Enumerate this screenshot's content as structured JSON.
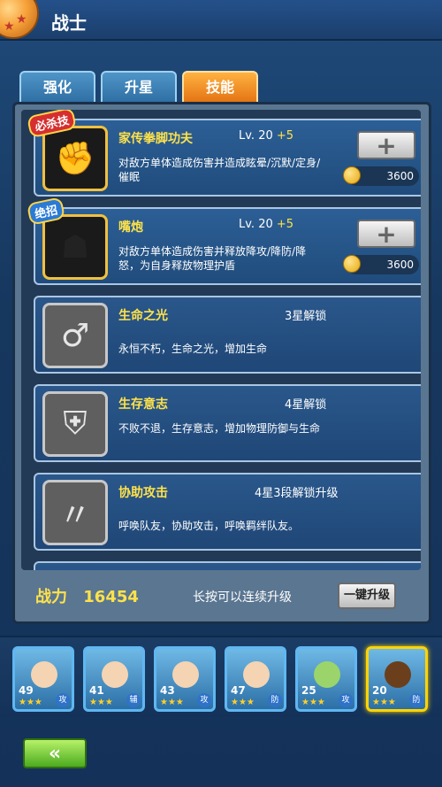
{
  "header": {
    "title": "战士"
  },
  "tabs": [
    {
      "label": "强化",
      "active": false
    },
    {
      "label": "升星",
      "active": false
    },
    {
      "label": "技能",
      "active": true
    }
  ],
  "skills": [
    {
      "badge": "必杀技",
      "name": "家传拳脚功夫",
      "level": "Lv. 20",
      "plus": "+5",
      "desc": "对敌方单体造成伤害并造成眩晕/沉默/定身/催眠",
      "cost": "3600",
      "locked": false
    },
    {
      "badge": "绝招",
      "name": "嘴炮",
      "level": "Lv. 20",
      "plus": "+5",
      "desc": "对敌方单体造成伤害并释放降攻/降防/降怒，为自身释放物理护盾",
      "cost": "3600",
      "locked": false
    },
    {
      "name": "生命之光",
      "unlock": "3星解锁",
      "desc": "永恒不朽，生命之光，增加生命",
      "locked": true
    },
    {
      "name": "生存意志",
      "unlock": "4星解锁",
      "desc": "不败不退，生存意志，增加物理防御与生命",
      "locked": true
    },
    {
      "name": "协助攻击",
      "unlock": "4星3段解锁升级",
      "desc": "呼唤队友，协助攻击，呼唤羁绊队友。",
      "locked": true
    }
  ],
  "footer": {
    "power_label": "战力",
    "power_value": "16454",
    "hint": "长按可以连续升级",
    "oneclick_label": "一键升级"
  },
  "heroes": [
    {
      "level": "49",
      "stars": "★★★",
      "tag": "攻"
    },
    {
      "level": "41",
      "stars": "★★★",
      "tag": "辅"
    },
    {
      "level": "43",
      "stars": "★★★",
      "tag": "攻"
    },
    {
      "level": "47",
      "stars": "★★★",
      "tag": "防"
    },
    {
      "level": "25",
      "stars": "★★★",
      "tag": "攻"
    },
    {
      "level": "20",
      "stars": "★★★",
      "tag": "防",
      "selected": true
    }
  ],
  "back": {
    "label": "«"
  }
}
